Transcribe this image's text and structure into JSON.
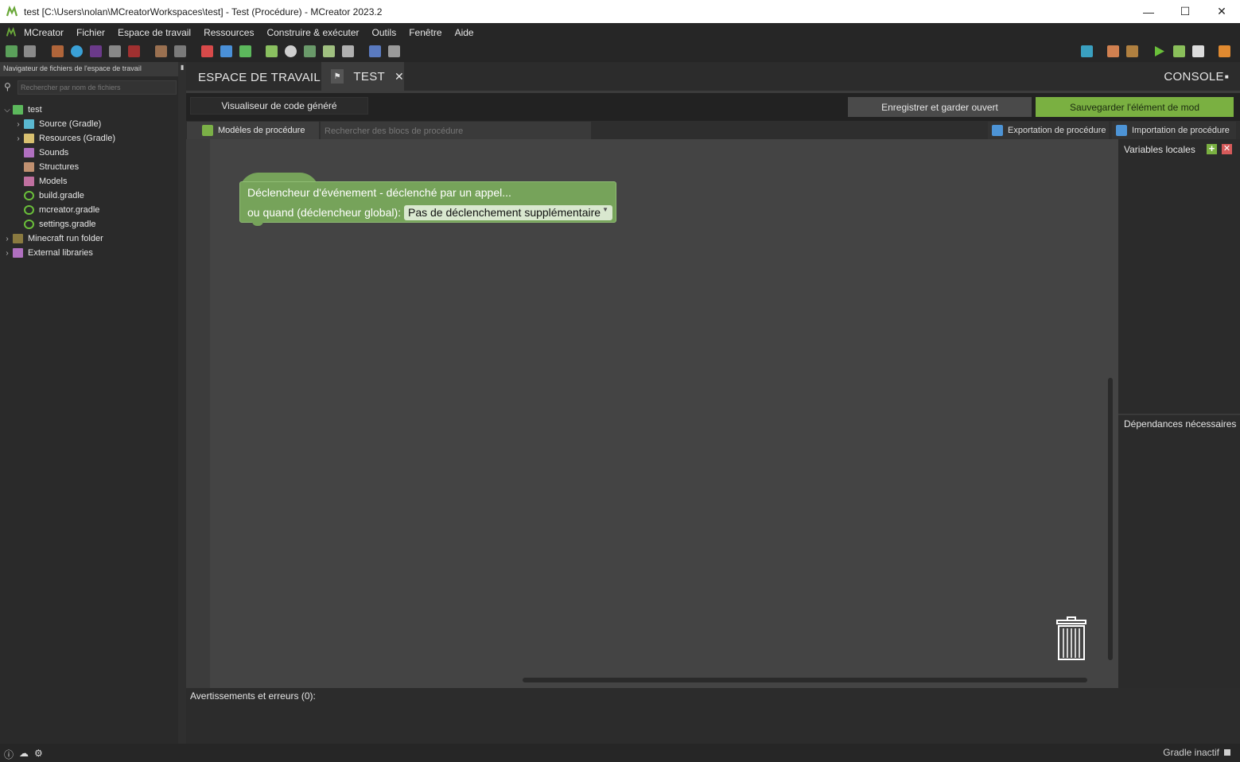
{
  "window": {
    "title": "test [C:\\Users\\nolan\\MCreatorWorkspaces\\test] - Test (Procédure) - MCreator 2023.2",
    "minimize": "—",
    "maximize": "☐",
    "close": "✕"
  },
  "menu": {
    "items": [
      "MCreator",
      "Fichier",
      "Espace de travail",
      "Ressources",
      "Construire & exécuter",
      "Outils",
      "Fenêtre",
      "Aide"
    ]
  },
  "left_panel": {
    "header": "Navigateur de fichiers de l'espace de travail",
    "search_placeholder": "Rechercher par nom de fichiers",
    "tree": [
      {
        "label": "test",
        "chevron": "⌵"
      },
      {
        "label": "Source (Gradle)",
        "chevron": "›"
      },
      {
        "label": "Resources (Gradle)",
        "chevron": "›"
      },
      {
        "label": "Sounds",
        "chevron": ""
      },
      {
        "label": "Structures",
        "chevron": ""
      },
      {
        "label": "Models",
        "chevron": ""
      },
      {
        "label": "build.gradle",
        "chevron": ""
      },
      {
        "label": "mcreator.gradle",
        "chevron": ""
      },
      {
        "label": "settings.gradle",
        "chevron": ""
      },
      {
        "label": "Minecraft run folder",
        "chevron": "›"
      },
      {
        "label": "External libraries",
        "chevron": "›"
      }
    ]
  },
  "tabs": {
    "workspace": "ESPACE DE TRAVAIL",
    "test": "TEST",
    "console": "CONSOLE"
  },
  "actions": {
    "code_viewer": "Visualiseur de code généré",
    "save_keep_open": "Enregistrer et garder ouvert",
    "save_mod_element": "Sauvegarder l'élément de mod"
  },
  "procedure_bar": {
    "templates": "Modèles de procédure",
    "search_placeholder": "Rechercher des blocs de procédure",
    "export": "Exportation de procédure",
    "import": "Importation de procédure"
  },
  "block": {
    "line1": "Déclencheur d'événement - déclenché par un appel...",
    "line2": "ou quand (déclencheur global):",
    "dropdown": "Pas de déclenchement supplémentaire"
  },
  "right_panel": {
    "local_vars": "Variables locales",
    "dependencies": "Dépendances nécessaires"
  },
  "warnings": {
    "label": "Avertissements et erreurs (0):"
  },
  "status": {
    "gradle": "Gradle inactif"
  },
  "colors": {
    "accent_green": "#7ab041",
    "block_green": "#76a35a"
  }
}
